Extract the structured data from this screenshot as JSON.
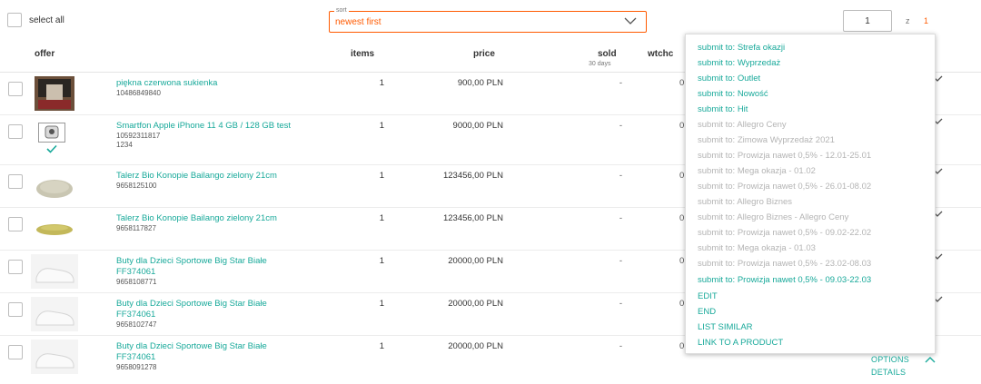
{
  "toolbar": {
    "select_all_label": "select all",
    "sort_legend": "sort",
    "sort_value": "newest first",
    "page_current": "1",
    "page_of": "z",
    "page_total": "1"
  },
  "columns": {
    "offer": "offer",
    "items": "items",
    "price": "price",
    "sold": "sold",
    "sold_sub": "30 days",
    "watch": "wtchc"
  },
  "rows": [
    {
      "title": "piękna czerwona sukienka",
      "lines": [
        "10486849840"
      ],
      "items": "1",
      "price": "900,00 PLN",
      "sold": "-",
      "watch": "0"
    },
    {
      "title": "Smartfon Apple iPhone 11 4 GB / 128 GB test",
      "lines": [
        "10592311817",
        "1234"
      ],
      "items": "1",
      "price": "9000,00 PLN",
      "sold": "-",
      "watch": "0"
    },
    {
      "title": "Talerz Bio Konopie Bailango zielony 21cm",
      "lines": [
        "9658125100"
      ],
      "items": "1",
      "price": "123456,00 PLN",
      "sold": "-",
      "watch": "0"
    },
    {
      "title": "Talerz Bio Konopie Bailango zielony 21cm",
      "lines": [
        "9658117827"
      ],
      "items": "1",
      "price": "123456,00 PLN",
      "sold": "-",
      "watch": "0"
    },
    {
      "title": "Buty dla Dzieci Sportowe Big Star Białe FF374061",
      "lines": [
        "9658108771"
      ],
      "items": "1",
      "price": "20000,00 PLN",
      "sold": "-",
      "watch": "0"
    },
    {
      "title": "Buty dla Dzieci Sportowe Big Star Białe FF374061",
      "lines": [
        "9658102747"
      ],
      "items": "1",
      "price": "20000,00 PLN",
      "sold": "-",
      "watch": "0"
    },
    {
      "title": "Buty dla Dzieci Sportowe Big Star Białe FF374061",
      "lines": [
        "9658091278"
      ],
      "items": "1",
      "price": "20000,00 PLN",
      "sold": "-",
      "watch": "0"
    }
  ],
  "menu": [
    {
      "label": "submit to: Strefa okazji",
      "enabled": true
    },
    {
      "label": "submit to: Wyprzedaż",
      "enabled": true
    },
    {
      "label": "submit to: Outlet",
      "enabled": true
    },
    {
      "label": "submit to: Nowość",
      "enabled": true
    },
    {
      "label": "submit to: Hit",
      "enabled": true
    },
    {
      "label": "submit to: Allegro Ceny",
      "enabled": false
    },
    {
      "label": "submit to: Zimowa Wyprzedaż 2021",
      "enabled": false
    },
    {
      "label": "submit to: Prowizja nawet 0,5% - 12.01-25.01",
      "enabled": false
    },
    {
      "label": "submit to: Mega okazja - 01.02",
      "enabled": false
    },
    {
      "label": "submit to: Prowizja nawet 0,5% - 26.01-08.02",
      "enabled": false
    },
    {
      "label": "submit to: Allegro Biznes",
      "enabled": false
    },
    {
      "label": "submit to: Allegro Biznes - Allegro Ceny",
      "enabled": false
    },
    {
      "label": "submit to: Prowizja nawet 0,5% - 09.02-22.02",
      "enabled": false
    },
    {
      "label": "submit to: Mega okazja - 01.03",
      "enabled": false
    },
    {
      "label": "submit to: Prowizja nawet 0,5% - 23.02-08.03",
      "enabled": false
    },
    {
      "label": "submit to: Prowizja nawet 0,5% - 09.03-22.03",
      "enabled": true
    },
    {
      "label": "EDIT",
      "enabled": true
    },
    {
      "label": "END",
      "enabled": true
    },
    {
      "label": "LIST SIMILAR",
      "enabled": true
    },
    {
      "label": "LINK TO A PRODUCT",
      "enabled": true
    }
  ],
  "footer_actions": {
    "options": "OPTIONS",
    "details": "DETAILS"
  },
  "colors": {
    "accent_teal": "#18a99a",
    "accent_orange": "#ff5a00",
    "disabled_gray": "#b4b4b4"
  }
}
